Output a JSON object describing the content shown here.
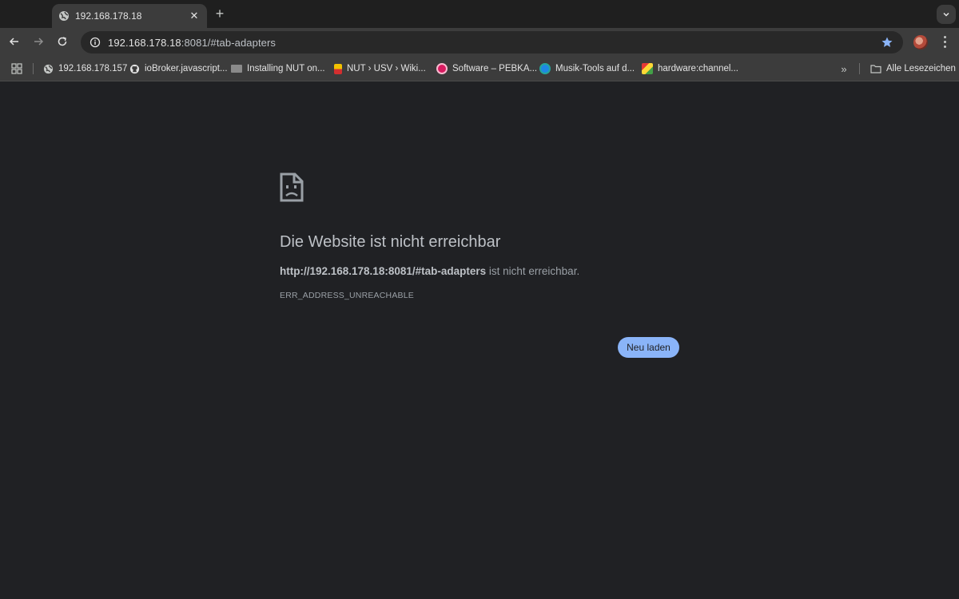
{
  "tabs": [
    {
      "title": "192.168.178.18",
      "favicon": "globe-icon"
    }
  ],
  "omnibox": {
    "url_host": "192.168.178.18",
    "url_rest": ":8081/#tab-adapters"
  },
  "bookmarks": [
    {
      "label": "192.168.178.157",
      "icon": "globe-icon"
    },
    {
      "label": "ioBroker.javascript...",
      "icon": "github-icon"
    },
    {
      "label": "Installing NUT on...",
      "icon": "nut-site-icon"
    },
    {
      "label": "NUT › USV › Wiki...",
      "icon": "wiki-icon"
    },
    {
      "label": "Software – PEBKA...",
      "icon": "raspberry-icon"
    },
    {
      "label": "Musik-Tools auf d...",
      "icon": "music-tools-icon"
    },
    {
      "label": "hardware:channel...",
      "icon": "channel-icon"
    }
  ],
  "bookmarks_all_label": "Alle Lesezeichen",
  "error": {
    "title": "Die Website ist nicht erreichbar",
    "url_bold": "http://192.168.178.18:8081/#tab-adapters",
    "message_suffix": " ist nicht erreichbar.",
    "code": "ERR_ADDRESS_UNREACHABLE",
    "reload_label": "Neu laden"
  },
  "colors": {
    "accent": "#8ab4f8",
    "star": "#8ab4f8",
    "background": "#202124"
  }
}
